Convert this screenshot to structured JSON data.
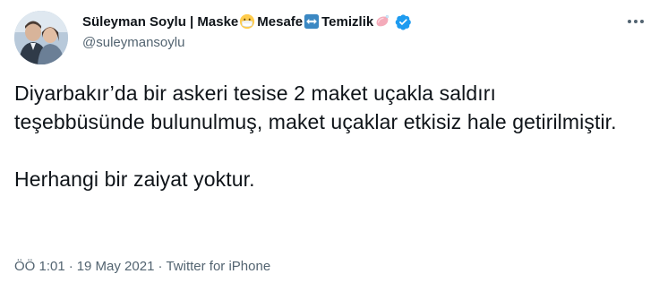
{
  "author": {
    "name_parts": [
      "Süleyman Soylu | Maske",
      "Mesafe",
      "Temizlik"
    ],
    "handle": "@suleymansoylu",
    "verified": true,
    "icons": [
      "avatar-photo",
      "mask-emoji-icon",
      "left-right-arrow-icon",
      "soap-icon",
      "verified-badge-icon",
      "more-options-icon"
    ]
  },
  "tweet": {
    "paragraphs": [
      "Diyarbakır’da bir askeri tesise 2 maket uçakla saldırı teşebbüsünde bulunulmuş, maket uçaklar etkisiz hale getirilmiştir.",
      "Herhangi bir zaiyat yoktur."
    ]
  },
  "meta": {
    "time": "ÖÖ 1:01",
    "separator": "·",
    "date": "19 May 2021",
    "source": "Twitter for iPhone"
  },
  "colors": {
    "text": "#0f1419",
    "secondary": "#536471",
    "verified": "#1d9bf0"
  }
}
